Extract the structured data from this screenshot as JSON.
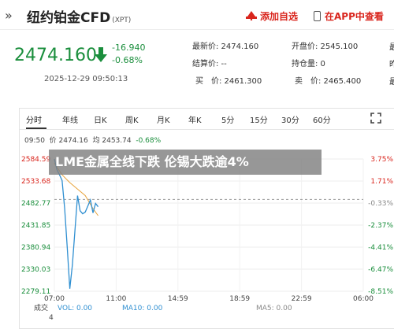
{
  "header": {
    "back_icon": "chevrons-left-icon",
    "title": "纽约铂金CFD",
    "title_sub": "(XPT)",
    "add_fav_label": "添加自选",
    "open_app_label": "在APP中查看",
    "accent": "#d9251d"
  },
  "quote": {
    "price": "2474.160",
    "change": "-16.940",
    "change_pct": "-0.68%",
    "timestamp": "2025-12-29 09:50:13",
    "latest_label": "最新价: 2474.160",
    "open_label": "开盘价: 2545.100",
    "settle_label": "结算价: --",
    "position_label": "持仓量: 0",
    "buy_label": "买　价: 2461.300",
    "sell_label": "卖　价: 2465.400",
    "edge_labels": [
      "最",
      "昨",
      "最"
    ],
    "down_color": "#1a8e3c"
  },
  "tabs": [
    "分时",
    "年线",
    "日K",
    "周K",
    "月K",
    "年K",
    "5分",
    "15分",
    "30分",
    "60分"
  ],
  "info": {
    "time": "09:50",
    "price": "价 2474.16",
    "avg": "均 2453.74",
    "pct": "-0.68%"
  },
  "headline": "LME金属全线下跌 伦锡大跌逾4%",
  "chart_data": {
    "type": "line",
    "y_left_ticks": [
      "2584.59",
      "2533.68",
      "2482.77",
      "2431.85",
      "2380.94",
      "2330.03",
      "2279.11"
    ],
    "y_right_ticks": [
      "3.75%",
      "1.71%",
      "-0.33%",
      "-2.37%",
      "-4.41%",
      "-6.47%",
      "-8.51%"
    ],
    "x_ticks": [
      "07:00",
      "11:00",
      "14:59",
      "18:59",
      "22:59",
      "06:00"
    ],
    "ylim": [
      2279.11,
      2584.59
    ],
    "prev_close": 2491.1,
    "price_series": {
      "name": "价",
      "x": [
        "07:00",
        "07:10",
        "07:20",
        "07:30",
        "07:40",
        "07:50",
        "08:00",
        "08:10",
        "08:20",
        "08:30",
        "08:40",
        "08:50",
        "09:00",
        "09:10",
        "09:20",
        "09:30",
        "09:40",
        "09:50"
      ],
      "values": [
        2584.6,
        2560,
        2548,
        2535,
        2470,
        2380,
        2285,
        2340,
        2420,
        2500,
        2465,
        2458,
        2462,
        2476,
        2490,
        2460,
        2482,
        2474.16
      ]
    },
    "avg_series": {
      "name": "均",
      "x": [
        "07:00",
        "07:30",
        "08:00",
        "08:30",
        "09:00",
        "09:30",
        "09:50"
      ],
      "values": [
        2575,
        2548,
        2530,
        2515,
        2500,
        2470,
        2453.74
      ]
    },
    "bottom_labels": [
      "成交",
      "VOL: 0.00",
      "MA10: 0.00",
      "MA5: 0.00",
      "4"
    ],
    "up_color": "#d9251d",
    "down_color": "#1a8e3c",
    "grid": true
  }
}
